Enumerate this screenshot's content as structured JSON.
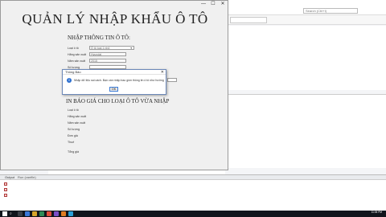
{
  "ide": {
    "title": "",
    "search_placeholder": "Search (Ctrl+I)",
    "tab_label": "",
    "output": {
      "title": "Output",
      "tab": "Run (vanfile)"
    }
  },
  "app": {
    "title": "QUẢN LÝ NHẬP KHẨU Ô TÔ",
    "section1_title": "NHẬP THÔNG TIN Ô TÔ:",
    "fields": [
      {
        "label": "Loại ô tô",
        "value": "Ô tô loại 1 nhỏ",
        "kind": "select"
      },
      {
        "label": "Hãng sản xuất",
        "value": "Hyundai",
        "kind": "text"
      },
      {
        "label": "Năm sản xuất",
        "value": "2015",
        "kind": "text"
      },
      {
        "label": "Số lượng",
        "value": "",
        "kind": "text"
      }
    ],
    "section2_title": "IN BÁO GIÁ CHO LOẠI Ô TÔ VỪA NHẬP",
    "report_labels": [
      "Loại ô tô",
      "Hãng sản xuất",
      "Năm sản xuất",
      "Số lượng",
      "Đơn giá",
      "Thuế",
      "Tổng giá"
    ],
    "window_controls": {
      "minimize": "—",
      "maximize": "☐",
      "close": "✕"
    }
  },
  "dialog": {
    "title": "Thông Báo",
    "icon": "info-icon",
    "message": "Nhập dữ liệu sai cách. Bạn cần nhập bao gồm thông tin ô tô như hướng dẫn",
    "ok_label": "OK",
    "close": "✕"
  },
  "taskbar": {
    "time": "11:05 PM",
    "date": "4/10/2021"
  }
}
